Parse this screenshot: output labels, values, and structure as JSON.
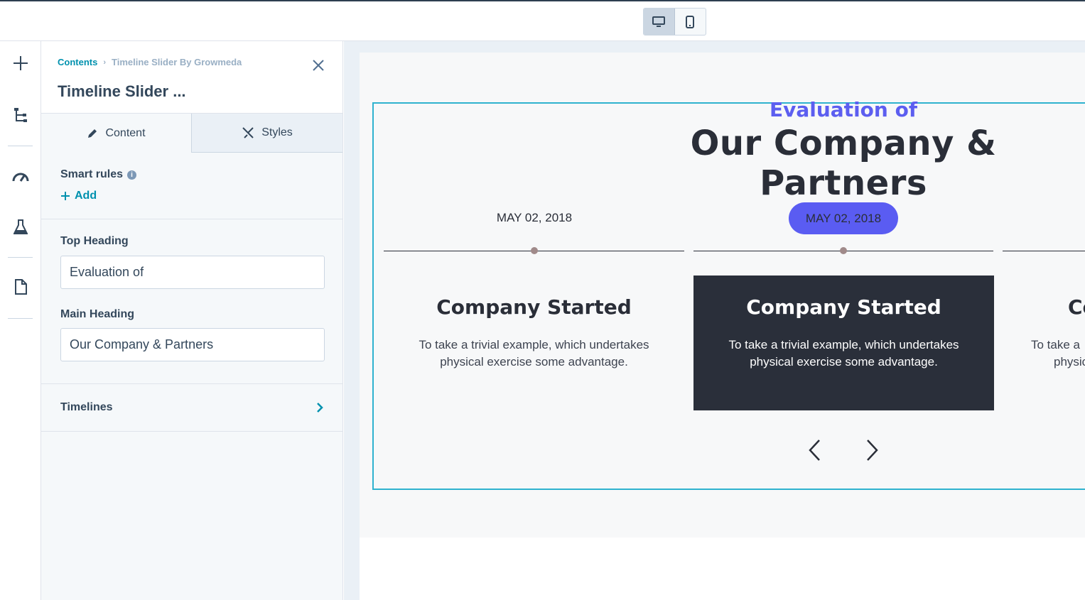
{
  "toolbar": {
    "device_toggle": [
      {
        "name": "desktop-icon",
        "active": true
      },
      {
        "name": "mobile-icon",
        "active": false
      }
    ]
  },
  "rail": {
    "icons": [
      "plus-icon",
      "tree-icon",
      "speedometer-icon",
      "flask-icon",
      "page-icon"
    ]
  },
  "panel": {
    "breadcrumb": {
      "root": "Contents",
      "current": "Timeline Slider By Growmeda"
    },
    "title": "Timeline Slider ...",
    "tabs": [
      {
        "label": "Content",
        "icon": "pencil-icon",
        "active": true
      },
      {
        "label": "Styles",
        "icon": "brush-icon",
        "active": false
      }
    ],
    "smart_rules": {
      "label": "Smart rules",
      "add_label": "Add"
    },
    "fields": {
      "top_heading": {
        "label": "Top Heading",
        "value": "Evaluation of"
      },
      "main_heading": {
        "label": "Main Heading",
        "value": "Our Company & Partners"
      }
    },
    "timelines": {
      "label": "Timelines"
    }
  },
  "preview": {
    "top_heading": "Evaluation of",
    "main_heading": "Our Company & Partners",
    "slides": [
      {
        "date": "MAY 02, 2018",
        "title": "Company Started",
        "text": "To take a trivial example, which undertakes physical exercise some advantage.",
        "active": false
      },
      {
        "date": "MAY 02, 2018",
        "title": "Company Started",
        "text": "To take a trivial example, which undertakes physical exercise some advantage.",
        "active": true
      },
      {
        "title_partial": "Co",
        "text_partial_1": "To take a",
        "text_partial_2": "physic"
      }
    ],
    "colors": {
      "accent": "#5a5cf2",
      "heading": "#2a2e38",
      "active_card": "#2a2f3a",
      "outline": "#2fb2cf",
      "link": "#0091ae"
    }
  }
}
